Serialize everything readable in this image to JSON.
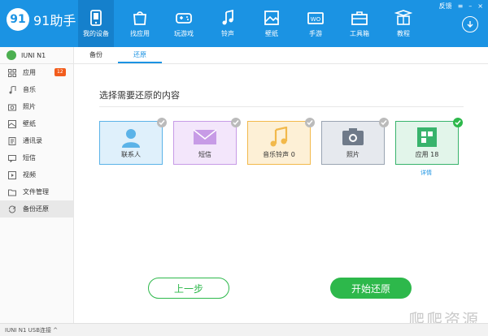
{
  "app": {
    "logo_text": "91助手",
    "logo_mark": "91"
  },
  "window_controls": {
    "feedback": "反馈",
    "menu": "≡",
    "minimize": "–",
    "close": "×"
  },
  "nav": [
    {
      "label": "我的设备",
      "icon": "device-icon"
    },
    {
      "label": "找应用",
      "icon": "app-store-icon"
    },
    {
      "label": "玩游戏",
      "icon": "game-icon"
    },
    {
      "label": "铃声",
      "icon": "music-note-icon"
    },
    {
      "label": "壁纸",
      "icon": "wallpaper-icon"
    },
    {
      "label": "手游",
      "icon": "mobile-game-icon"
    },
    {
      "label": "工具箱",
      "icon": "toolbox-icon"
    },
    {
      "label": "教程",
      "icon": "tutorial-icon"
    }
  ],
  "sidebar": {
    "device": "IUNI N1",
    "items": [
      {
        "label": "应用",
        "badge": "12"
      },
      {
        "label": "音乐"
      },
      {
        "label": "照片"
      },
      {
        "label": "壁纸"
      },
      {
        "label": "通讯录"
      },
      {
        "label": "短信"
      },
      {
        "label": "视频"
      },
      {
        "label": "文件管理"
      },
      {
        "label": "备份还原"
      }
    ]
  },
  "tabs": [
    {
      "label": "备份"
    },
    {
      "label": "还原"
    }
  ],
  "main": {
    "title": "选择需要还原的内容",
    "cards": [
      {
        "label": "联系人",
        "bg": "#dff0fb",
        "border": "#5bb3e8"
      },
      {
        "label": "短信",
        "bg": "#f3e6fb",
        "border": "#c79be6"
      },
      {
        "label": "音乐铃声 0",
        "bg": "#fdf0d6",
        "border": "#f2b94b"
      },
      {
        "label": "照片",
        "bg": "#e6e9ee",
        "border": "#9aa4b2"
      },
      {
        "label": "应用 18",
        "bg": "#e2f5ea",
        "border": "#38b36c"
      }
    ],
    "detail_link": "详情",
    "prev_button": "上一步",
    "start_button": "开始还原"
  },
  "status": {
    "text": "IUNI N1   USB连接 ^"
  },
  "watermark": "爬爬资源",
  "colors": {
    "brand": "#1b93e3",
    "success": "#2db84b"
  }
}
